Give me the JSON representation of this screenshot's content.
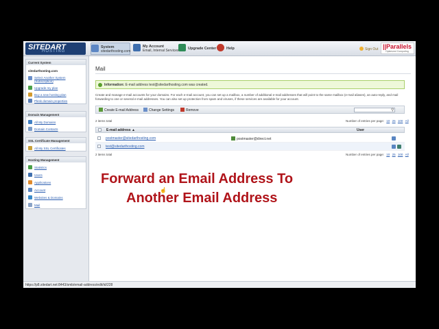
{
  "topbar": {
    "logo_main": "SITEDART",
    "logo_sub": "HOSTING",
    "tabs": [
      {
        "title": "System",
        "subtitle": "sitedarthosting.com"
      },
      {
        "title": "My Account",
        "subtitle": "Email, Internal Services"
      },
      {
        "title": "Upgrade Center",
        "subtitle": ""
      },
      {
        "title": "Help",
        "subtitle": ""
      }
    ],
    "signout": "Sign Out",
    "brand": "||Parallels",
    "brand_sub": "Optimized Computing"
  },
  "sidebar": {
    "current_system": {
      "header": "Current System",
      "domain": "sitedarthosting.com",
      "items": [
        "Select Another System (Subscription)",
        "Upgrade my plan",
        "Buy a new hosting plan",
        "Plesk domain properties"
      ]
    },
    "domain_mgmt": {
      "header": "Domain Management",
      "items": [
        "All My Domains",
        "Domain Contacts"
      ]
    },
    "ssl_mgmt": {
      "header": "SSL Certificate Management",
      "items": [
        "All My SSL Certificates"
      ]
    },
    "hosting_mgmt": {
      "header": "Hosting Management",
      "items": [
        "Statistics",
        "Users",
        "Applications",
        "Account",
        "Websites & Domains",
        "Mail"
      ]
    }
  },
  "main": {
    "title": "Mail",
    "info_label": "Information:",
    "info_text": "E-mail address test@sitedarthosting.com was created.",
    "description": "Create and manage e-mail accounts for your domains. For each e-mail account, you can set up a mailbox, a number of additional e-mail addresses that will point to the same mailbox (e-mail aliases), an auto-reply, and mail forwarding to one or several e-mail addresses. You can also set up protection from spam and viruses, if these services are available for your account.",
    "toolbar": {
      "create": "Create E-mail Address",
      "settings": "Change Settings",
      "remove": "Remove"
    },
    "items_total": "2 items total",
    "entries_label": "Number of entries per page:",
    "pages": [
      "10",
      "25",
      "100",
      "All"
    ],
    "columns": {
      "email": "E-mail address ▲",
      "user": "User"
    },
    "rows": [
      {
        "email": "postmaster@sitedarthosting.com",
        "user": "postmaster@direct.net"
      },
      {
        "email": "test@sitedarthosting.com",
        "user": ""
      }
    ]
  },
  "caption": {
    "line1": "Forward an Email Address To",
    "line2": "Another Email Address"
  },
  "status_url": "https://p8.sitedart.net:8443/smb/email-address/edit/id/228",
  "colors": {
    "caption": "#b0141a",
    "link": "#2a5db0",
    "info_bg": "#eef8d9"
  }
}
